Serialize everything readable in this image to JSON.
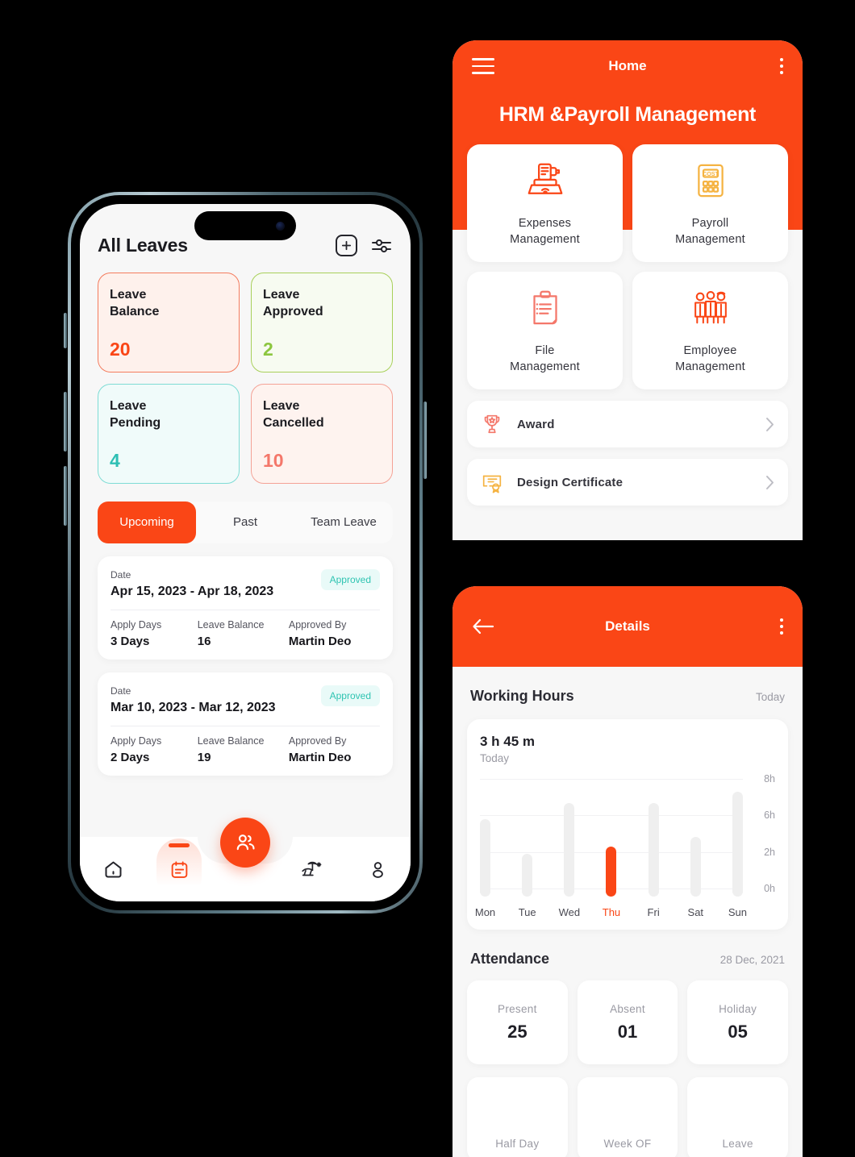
{
  "colors": {
    "brand_orange": "#FA4616",
    "green": "#8CC63F",
    "teal": "#2EBFB4",
    "salmon": "#F4776A",
    "badge_teal": "#2FC4B2"
  },
  "leaves_screen": {
    "title": "All Leaves",
    "add_icon": "plus-icon",
    "filter_icon": "sliders-filter-icon",
    "stats": [
      {
        "label": "Leave\nBalance",
        "label_line1": "Leave",
        "label_line2": "Balance",
        "value": "20",
        "value_color": "#FA4616",
        "bg": "#FEF1EC",
        "border": "#F47C5E"
      },
      {
        "label_line1": "Leave",
        "label_line2": "Approved",
        "value": "2",
        "value_color": "#8CC63F",
        "bg": "#F7FBF1",
        "border": "#A8D05A"
      },
      {
        "label_line1": "Leave",
        "label_line2": "Pending",
        "value": "4",
        "value_color": "#2EBFB4",
        "bg": "#F0FBFA",
        "border": "#7FDCD5"
      },
      {
        "label_line1": "Leave",
        "label_line2": "Cancelled",
        "value": "10",
        "value_color": "#F4776A",
        "bg": "#FEF3EF",
        "border": "#F4A296"
      }
    ],
    "tabs": [
      {
        "label": "Upcoming",
        "active": true
      },
      {
        "label": "Past",
        "active": false
      },
      {
        "label": "Team Leave",
        "active": false
      }
    ],
    "leave_cards": [
      {
        "date_label": "Date",
        "date_value": "Apr 15, 2023 - Apr 18, 2023",
        "status": "Approved",
        "fields": [
          {
            "key": "Apply Days",
            "value": "3 Days"
          },
          {
            "key": "Leave Balance",
            "value": "16"
          },
          {
            "key": "Approved By",
            "value": "Martin Deo"
          }
        ]
      },
      {
        "date_label": "Date",
        "date_value": "Mar 10, 2023 - Mar 12, 2023",
        "status": "Approved",
        "fields": [
          {
            "key": "Apply Days",
            "value": "2 Days"
          },
          {
            "key": "Leave Balance",
            "value": "19"
          },
          {
            "key": "Approved By",
            "value": "Martin Deo"
          }
        ]
      }
    ],
    "bottom_nav": [
      {
        "icon": "home-icon",
        "active": false
      },
      {
        "icon": "calendar-icon",
        "active": true
      },
      {
        "icon": "people-fab-icon",
        "active": false
      },
      {
        "icon": "beach-vacation-icon",
        "active": false
      },
      {
        "icon": "profile-person-icon",
        "active": false
      }
    ]
  },
  "home_screen": {
    "menu_icon": "hamburger-menu-icon",
    "appbar_title": "Home",
    "overflow_icon": "kebab-more-icon",
    "page_title": "HRM &Payroll Management",
    "tiles": [
      {
        "icon": "expenses-printer-icon",
        "line1": "Expenses",
        "line2": "Management",
        "icon_color": "#FA4616"
      },
      {
        "icon": "payroll-calculator-icon",
        "line1": "Payroll",
        "line2": "Management",
        "icon_color": "#F5B342"
      },
      {
        "icon": "file-clipboard-icon",
        "line1": "File",
        "line2": "Management",
        "icon_color": "#F4776A"
      },
      {
        "icon": "employee-group-icon",
        "line1": "Employee",
        "line2": "Management",
        "icon_color": "#FA4616"
      }
    ],
    "rows": [
      {
        "icon": "trophy-award-icon",
        "label": "Award",
        "chevron": "chevron-right-icon",
        "icon_color": "#F4776A"
      },
      {
        "icon": "certificate-icon",
        "label": "Design Certificate",
        "chevron": "chevron-right-icon",
        "icon_color": "#F5B342"
      }
    ]
  },
  "details_screen": {
    "back_icon": "arrow-left-icon",
    "title": "Details",
    "overflow_icon": "kebab-more-icon",
    "working_hours": {
      "section_title": "Working Hours",
      "section_meta": "Today",
      "total": "3 h 45 m",
      "total_sub": "Today"
    },
    "attendance": {
      "section_title": "Attendance",
      "section_meta": "28 Dec, 2021",
      "cards": [
        {
          "label": "Present",
          "value": "25"
        },
        {
          "label": "Absent",
          "value": "01"
        },
        {
          "label": "Holiday",
          "value": "05"
        },
        {
          "label": "Half Day",
          "value": ""
        },
        {
          "label": "Week OF",
          "value": ""
        },
        {
          "label": "Leave",
          "value": ""
        }
      ]
    }
  },
  "chart_data": {
    "type": "bar",
    "title": "Working Hours",
    "subtitle": "3 h 45 m Today",
    "categories": [
      "Mon",
      "Tue",
      "Wed",
      "Thu",
      "Fri",
      "Sat",
      "Sun"
    ],
    "values": [
      5.8,
      3.2,
      7.0,
      3.75,
      7.0,
      4.5,
      7.9
    ],
    "highlight_index": 3,
    "highlight_color": "#FA4616",
    "bar_color": "#EFEFEF",
    "ytick_labels": [
      "8h",
      "6h",
      "2h",
      "0h"
    ],
    "ytick_values": [
      8,
      6,
      2,
      0
    ],
    "ylim": [
      0,
      8
    ],
    "xlabel": "",
    "ylabel": "",
    "grid": true,
    "legend": "none"
  }
}
